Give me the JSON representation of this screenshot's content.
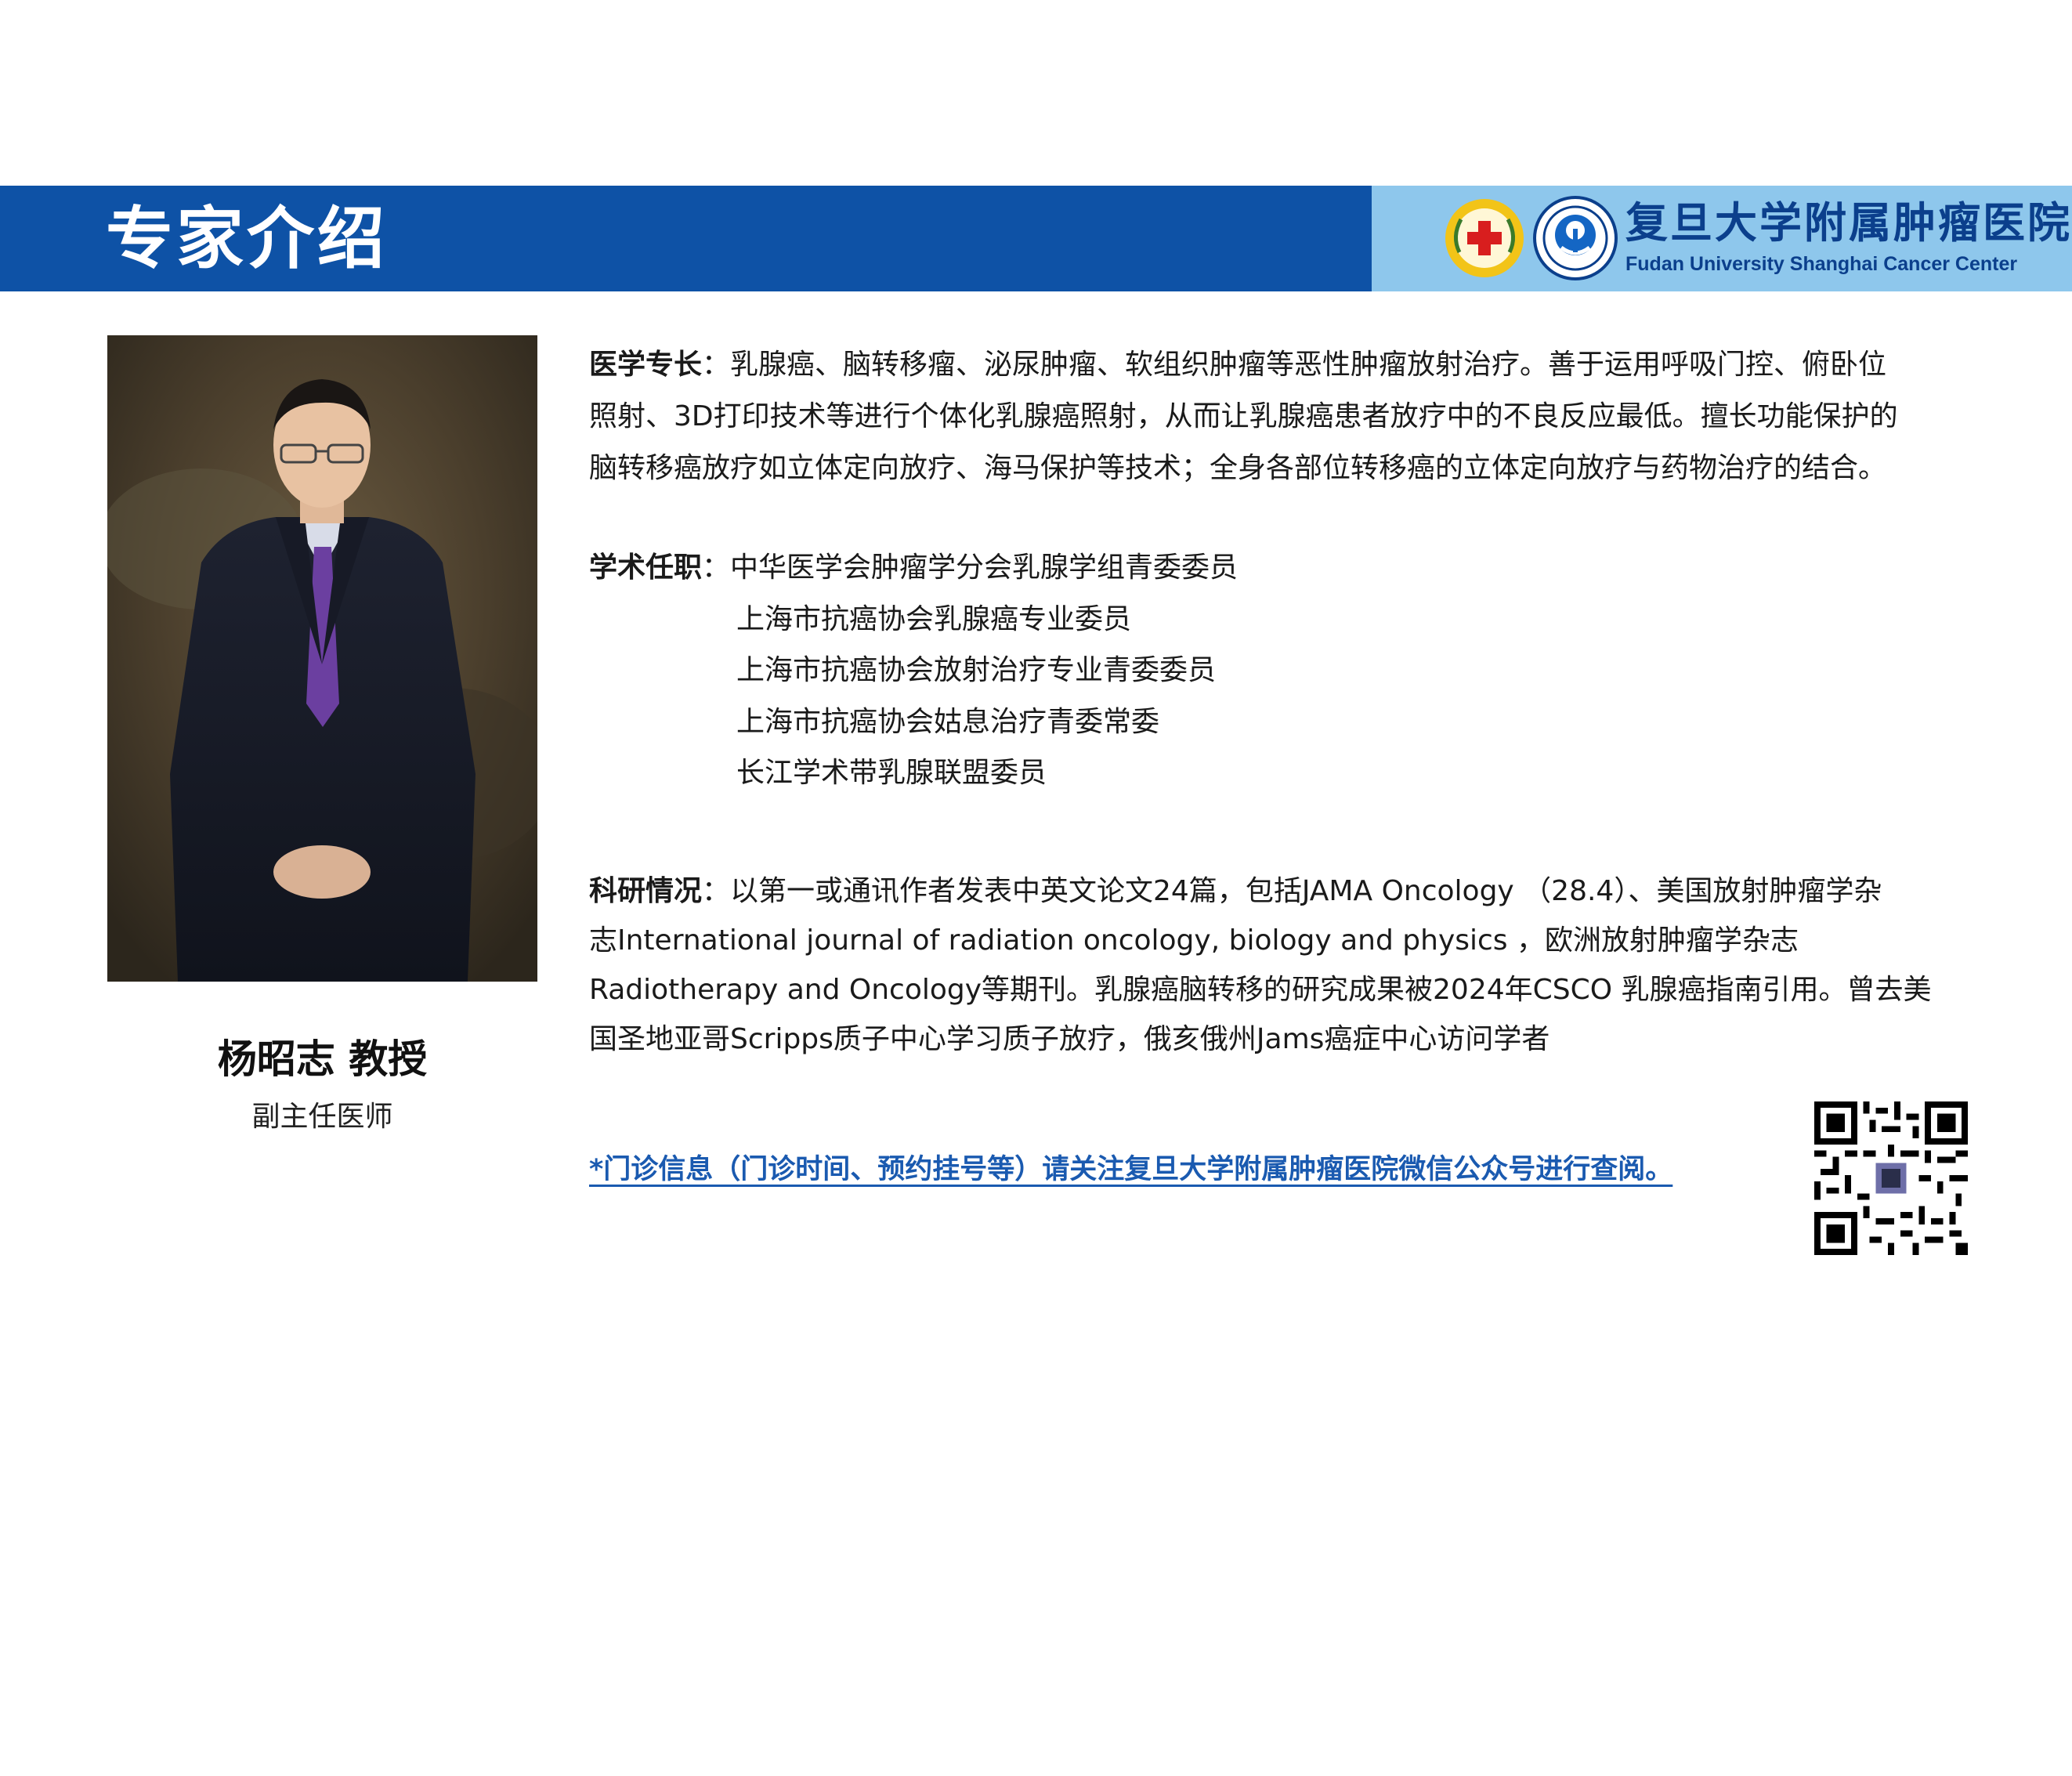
{
  "header": {
    "title": "专家介绍",
    "hospital_name_cn": "复旦大学附属肿瘤医院",
    "hospital_name_en": "Fudan University Shanghai Cancer Center",
    "bar_color": "#0e52a6",
    "logo_area_color": "#8ec7ec"
  },
  "doctor": {
    "name": "杨昭志 教授",
    "position": "副主任医师"
  },
  "specialty": {
    "label": "医学专长",
    "lines": [
      "：乳腺癌、脑转移瘤、泌尿肿瘤、软组织肿瘤等恶性肿瘤放射治疗。善于运用呼吸门控、俯卧位",
      "照射、3D打印技术等进行个体化乳腺癌照射，从而让乳腺癌患者放疗中的不良反应最低。擅长功能保护的",
      "脑转移癌放疗如立体定向放疗、海马保护等技术；全身各部位转移癌的立体定向放疗与药物治疗的结合。"
    ]
  },
  "academic": {
    "label": "学术任职",
    "colon": "：",
    "roles": [
      "中华医学会肿瘤学分会乳腺学组青委委员",
      "上海市抗癌协会乳腺癌专业委员",
      "上海市抗癌协会放射治疗专业青委委员",
      "上海市抗癌协会姑息治疗青委常委",
      "长江学术带乳腺联盟委员"
    ]
  },
  "research": {
    "label": "科研情况",
    "lines": [
      "：以第一或通讯作者发表中英文论文24篇，包括JAMA Oncology （28.4）、美国放射肿瘤学杂",
      "志International journal of  radiation oncology, biology and physics ，欧洲放射肿瘤学杂志",
      "Radiotherapy and Oncology等期刊。乳腺癌脑转移的研究成果被2024年CSCO 乳腺癌指南引用。曾去美",
      "国圣地亚哥Scripps质子中心学习质子放疗，俄亥俄州Jams癌症中心访问学者"
    ]
  },
  "notice": {
    "text": "*门诊信息（门诊时间、预约挂号等）请关注复旦大学附属肿瘤医院微信公众号进行查阅。",
    "color": "#1a5ab0"
  },
  "icons": {
    "emblem_left": "red-cross-emblem-icon",
    "emblem_right": "hospital-emblem-icon",
    "qr": "wechat-qr-code-icon"
  }
}
